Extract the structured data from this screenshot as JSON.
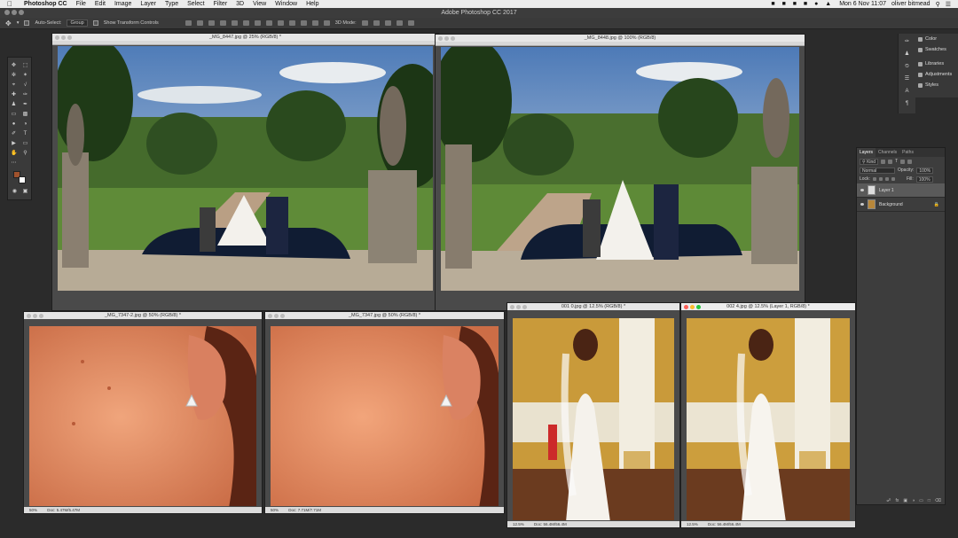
{
  "menubar": {
    "apple": "",
    "items": [
      "Photoshop CC",
      "File",
      "Edit",
      "Image",
      "Layer",
      "Type",
      "Select",
      "Filter",
      "3D",
      "View",
      "Window",
      "Help"
    ],
    "status": {
      "time": "Mon 6 Nov  11:07",
      "user": "oliver bitmead"
    }
  },
  "app": {
    "title": "Adobe Photoshop CC 2017"
  },
  "options": {
    "auto_select_label": "Auto-Select:",
    "auto_select_value": "Group",
    "show_transform_label": "Show Transform Controls",
    "mode_3d_label": "3D Mode:"
  },
  "documents": [
    {
      "id": "d1",
      "title": "_MG_8447.jpg @ 25% (RGB/8) *"
    },
    {
      "id": "d2",
      "title": "_MG_8448.jpg @ 100% (RGB/8)"
    },
    {
      "id": "d3",
      "title": "_MG_7347-2.jpg @ 50% (RGB/8) *",
      "zoom": "50%",
      "doc_size": "Doc: 5.47M/5.47M"
    },
    {
      "id": "d4",
      "title": "_MG_7347.jpg @ 50% (RGB/8) *",
      "zoom": "50%",
      "doc_size": "Doc: 7.71M/7.71M"
    },
    {
      "id": "d5",
      "title": "001 0.jpg @ 12.5% (RGB/8) *",
      "zoom": "12.5%",
      "doc_size": "Doc: 56.4M/56.4M"
    },
    {
      "id": "d6",
      "title": "002 4.jpg @ 12.5% (Layer 1, RGB/8) *",
      "zoom": "12.5%",
      "doc_size": "Doc: 56.4M/56.4M"
    }
  ],
  "panels": {
    "collapsed": [
      "Color",
      "Swatches",
      "Libraries",
      "Adjustments",
      "Styles"
    ]
  },
  "layers": {
    "tabs": [
      "Layers",
      "Channels",
      "Paths"
    ],
    "kind_label": "Kind",
    "blend_mode": "Normal",
    "opacity_label": "Opacity:",
    "opacity_value": "100%",
    "lock_label": "Lock:",
    "fill_label": "Fill:",
    "fill_value": "100%",
    "items": [
      {
        "name": "Layer 1",
        "selected": true
      },
      {
        "name": "Background",
        "selected": false
      }
    ]
  },
  "colors": {
    "foreground": "#a0522d",
    "background": "#ffffff",
    "workspace": "#2b2b2b"
  }
}
